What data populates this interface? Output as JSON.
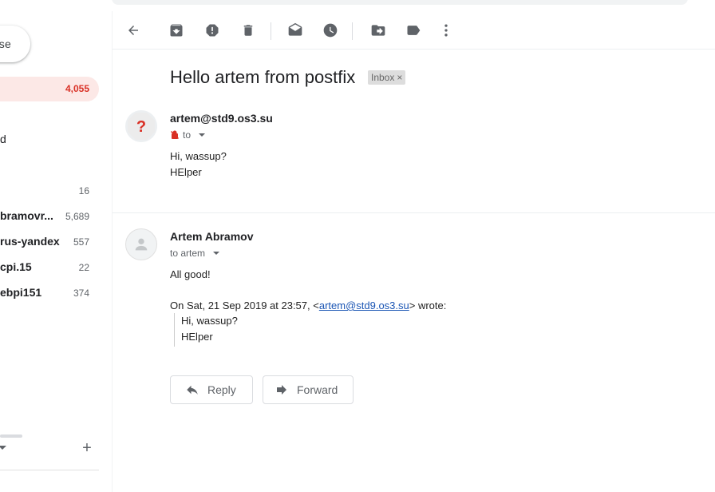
{
  "sidebar": {
    "compose_label": "se",
    "active_item": {
      "count": "4,055"
    },
    "items": [
      {
        "label": "d",
        "count": "",
        "bold": false
      },
      {
        "label": "",
        "count": "16",
        "bold": false
      },
      {
        "label": "bramovr...",
        "count": "5,689",
        "bold": true
      },
      {
        "label": "rus-yandex",
        "count": "557",
        "bold": true
      },
      {
        "label": "cpi.15",
        "count": "22",
        "bold": true
      },
      {
        "label": "ebpi151",
        "count": "374",
        "bold": true
      }
    ],
    "add_label": "+"
  },
  "toolbar": {
    "icons": [
      "back-arrow-icon",
      "archive-icon",
      "report-spam-icon",
      "delete-icon",
      "mark-unread-icon",
      "snooze-icon",
      "move-to-icon",
      "labels-icon",
      "more-icon"
    ]
  },
  "thread": {
    "subject": "Hello artem from postfix",
    "label": "Inbox",
    "label_remove": "×",
    "messages": [
      {
        "sender": "artem@std9.os3.su",
        "to": "to",
        "body": [
          "Hi, wassup?",
          "HElper"
        ]
      },
      {
        "sender": "Artem Abramov",
        "to": "to artem",
        "body": [
          "All good!"
        ],
        "quote_header_prefix": "On Sat, 21 Sep 2019 at 23:57, <",
        "quote_header_link": "artem@std9.os3.su",
        "quote_header_suffix": "> wrote:",
        "quoted": [
          "Hi, wassup?",
          "HElper"
        ]
      }
    ]
  },
  "actions": {
    "reply_label": "Reply",
    "forward_label": "Forward"
  },
  "colors": {
    "accent_red": "#d93025",
    "link_blue": "#1a55b4",
    "active_bg": "#fce8e6"
  }
}
